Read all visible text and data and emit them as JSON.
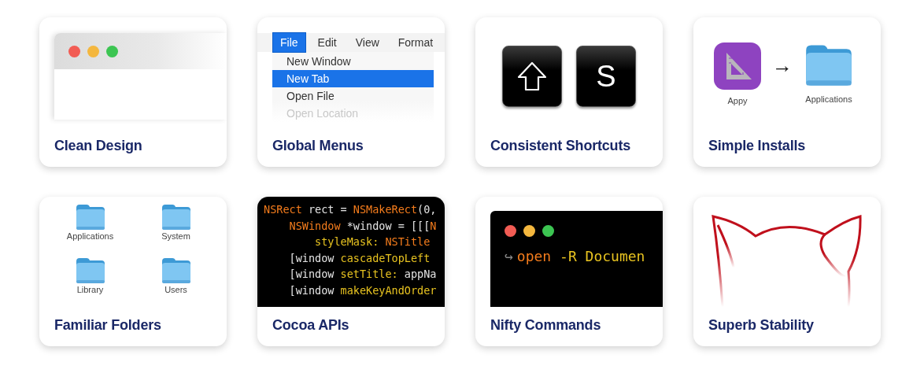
{
  "cards": [
    {
      "kind": "window",
      "title": "Clean Design",
      "dots": [
        {
          "color": "#f25c54"
        },
        {
          "color": "#f4b73e"
        },
        {
          "color": "#3cc552"
        }
      ]
    },
    {
      "kind": "menu",
      "title": "Global Menus",
      "menubar": [
        {
          "label": "File",
          "selected": true
        },
        {
          "label": "Edit",
          "selected": false
        },
        {
          "label": "View",
          "selected": false
        },
        {
          "label": "Format",
          "selected": false
        }
      ],
      "entries": [
        {
          "label": "New Window",
          "selected": false,
          "disabled": false
        },
        {
          "label": "New Tab",
          "selected": true,
          "disabled": false
        },
        {
          "label": "Open File",
          "selected": false,
          "disabled": false
        },
        {
          "label": "Open Location",
          "selected": false,
          "disabled": true
        }
      ]
    },
    {
      "kind": "keys",
      "title": "Consistent Shortcuts",
      "keys": [
        {
          "kind": "shift"
        },
        {
          "kind": "letter",
          "label": "S"
        }
      ]
    },
    {
      "kind": "install",
      "title": "Simple Installs",
      "app_label": "Appy",
      "arrow": "→",
      "target_label": "Applications"
    },
    {
      "kind": "folders",
      "title": "Familiar Folders",
      "folders": [
        "Applications",
        "System",
        "Library",
        "Users"
      ]
    },
    {
      "kind": "code",
      "title": "Cocoa APIs",
      "lines": [
        {
          "kind": "top",
          "tokens": [
            {
              "kind": "type",
              "text": "NSRect"
            },
            {
              "kind": "plain",
              "text": " rect = "
            },
            {
              "kind": "type",
              "text": "NSMakeRect"
            },
            {
              "kind": "plain",
              "text": "(0,"
            }
          ]
        },
        {
          "kind": "inner",
          "tokens": [
            {
              "kind": "type",
              "text": "NSWindow"
            },
            {
              "kind": "plain",
              "text": " *window = [[["
            },
            {
              "kind": "type",
              "text": "N"
            }
          ]
        },
        {
          "kind": "deep",
          "tokens": [
            {
              "kind": "method",
              "text": "styleMask: "
            },
            {
              "kind": "type",
              "text": "NSTitle"
            }
          ]
        },
        {
          "kind": "inner",
          "tokens": [
            {
              "kind": "plain",
              "text": "[window "
            },
            {
              "kind": "method",
              "text": "cascadeTopLeft"
            }
          ]
        },
        {
          "kind": "inner",
          "tokens": [
            {
              "kind": "plain",
              "text": "[window "
            },
            {
              "kind": "method",
              "text": "setTitle:"
            },
            {
              "kind": "plain",
              "text": " appNa"
            }
          ]
        },
        {
          "kind": "inner",
          "tokens": [
            {
              "kind": "plain",
              "text": "[window "
            },
            {
              "kind": "method",
              "text": "makeKeyAndOrder"
            }
          ]
        }
      ]
    },
    {
      "kind": "terminal",
      "title": "Nifty Commands",
      "dots": [
        {
          "color": "#f25c54"
        },
        {
          "color": "#f4b73e"
        },
        {
          "color": "#3cc552"
        }
      ],
      "prompt": "↪",
      "command": "open",
      "args": " -R Documen"
    },
    {
      "kind": "cat",
      "title": "Superb Stability"
    }
  ]
}
